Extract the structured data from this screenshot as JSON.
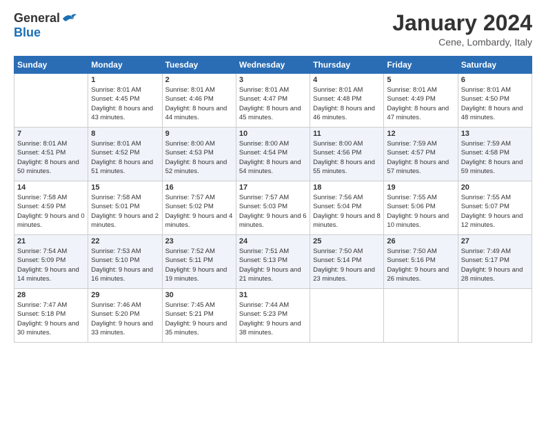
{
  "header": {
    "logo_general": "General",
    "logo_blue": "Blue",
    "month_title": "January 2024",
    "location": "Cene, Lombardy, Italy"
  },
  "weekdays": [
    "Sunday",
    "Monday",
    "Tuesday",
    "Wednesday",
    "Thursday",
    "Friday",
    "Saturday"
  ],
  "weeks": [
    [
      {
        "day": "",
        "sunrise": "",
        "sunset": "",
        "daylight": ""
      },
      {
        "day": "1",
        "sunrise": "Sunrise: 8:01 AM",
        "sunset": "Sunset: 4:45 PM",
        "daylight": "Daylight: 8 hours and 43 minutes."
      },
      {
        "day": "2",
        "sunrise": "Sunrise: 8:01 AM",
        "sunset": "Sunset: 4:46 PM",
        "daylight": "Daylight: 8 hours and 44 minutes."
      },
      {
        "day": "3",
        "sunrise": "Sunrise: 8:01 AM",
        "sunset": "Sunset: 4:47 PM",
        "daylight": "Daylight: 8 hours and 45 minutes."
      },
      {
        "day": "4",
        "sunrise": "Sunrise: 8:01 AM",
        "sunset": "Sunset: 4:48 PM",
        "daylight": "Daylight: 8 hours and 46 minutes."
      },
      {
        "day": "5",
        "sunrise": "Sunrise: 8:01 AM",
        "sunset": "Sunset: 4:49 PM",
        "daylight": "Daylight: 8 hours and 47 minutes."
      },
      {
        "day": "6",
        "sunrise": "Sunrise: 8:01 AM",
        "sunset": "Sunset: 4:50 PM",
        "daylight": "Daylight: 8 hours and 48 minutes."
      }
    ],
    [
      {
        "day": "7",
        "sunrise": "Sunrise: 8:01 AM",
        "sunset": "Sunset: 4:51 PM",
        "daylight": "Daylight: 8 hours and 50 minutes."
      },
      {
        "day": "8",
        "sunrise": "Sunrise: 8:01 AM",
        "sunset": "Sunset: 4:52 PM",
        "daylight": "Daylight: 8 hours and 51 minutes."
      },
      {
        "day": "9",
        "sunrise": "Sunrise: 8:00 AM",
        "sunset": "Sunset: 4:53 PM",
        "daylight": "Daylight: 8 hours and 52 minutes."
      },
      {
        "day": "10",
        "sunrise": "Sunrise: 8:00 AM",
        "sunset": "Sunset: 4:54 PM",
        "daylight": "Daylight: 8 hours and 54 minutes."
      },
      {
        "day": "11",
        "sunrise": "Sunrise: 8:00 AM",
        "sunset": "Sunset: 4:56 PM",
        "daylight": "Daylight: 8 hours and 55 minutes."
      },
      {
        "day": "12",
        "sunrise": "Sunrise: 7:59 AM",
        "sunset": "Sunset: 4:57 PM",
        "daylight": "Daylight: 8 hours and 57 minutes."
      },
      {
        "day": "13",
        "sunrise": "Sunrise: 7:59 AM",
        "sunset": "Sunset: 4:58 PM",
        "daylight": "Daylight: 8 hours and 59 minutes."
      }
    ],
    [
      {
        "day": "14",
        "sunrise": "Sunrise: 7:58 AM",
        "sunset": "Sunset: 4:59 PM",
        "daylight": "Daylight: 9 hours and 0 minutes."
      },
      {
        "day": "15",
        "sunrise": "Sunrise: 7:58 AM",
        "sunset": "Sunset: 5:01 PM",
        "daylight": "Daylight: 9 hours and 2 minutes."
      },
      {
        "day": "16",
        "sunrise": "Sunrise: 7:57 AM",
        "sunset": "Sunset: 5:02 PM",
        "daylight": "Daylight: 9 hours and 4 minutes."
      },
      {
        "day": "17",
        "sunrise": "Sunrise: 7:57 AM",
        "sunset": "Sunset: 5:03 PM",
        "daylight": "Daylight: 9 hours and 6 minutes."
      },
      {
        "day": "18",
        "sunrise": "Sunrise: 7:56 AM",
        "sunset": "Sunset: 5:04 PM",
        "daylight": "Daylight: 9 hours and 8 minutes."
      },
      {
        "day": "19",
        "sunrise": "Sunrise: 7:55 AM",
        "sunset": "Sunset: 5:06 PM",
        "daylight": "Daylight: 9 hours and 10 minutes."
      },
      {
        "day": "20",
        "sunrise": "Sunrise: 7:55 AM",
        "sunset": "Sunset: 5:07 PM",
        "daylight": "Daylight: 9 hours and 12 minutes."
      }
    ],
    [
      {
        "day": "21",
        "sunrise": "Sunrise: 7:54 AM",
        "sunset": "Sunset: 5:09 PM",
        "daylight": "Daylight: 9 hours and 14 minutes."
      },
      {
        "day": "22",
        "sunrise": "Sunrise: 7:53 AM",
        "sunset": "Sunset: 5:10 PM",
        "daylight": "Daylight: 9 hours and 16 minutes."
      },
      {
        "day": "23",
        "sunrise": "Sunrise: 7:52 AM",
        "sunset": "Sunset: 5:11 PM",
        "daylight": "Daylight: 9 hours and 19 minutes."
      },
      {
        "day": "24",
        "sunrise": "Sunrise: 7:51 AM",
        "sunset": "Sunset: 5:13 PM",
        "daylight": "Daylight: 9 hours and 21 minutes."
      },
      {
        "day": "25",
        "sunrise": "Sunrise: 7:50 AM",
        "sunset": "Sunset: 5:14 PM",
        "daylight": "Daylight: 9 hours and 23 minutes."
      },
      {
        "day": "26",
        "sunrise": "Sunrise: 7:50 AM",
        "sunset": "Sunset: 5:16 PM",
        "daylight": "Daylight: 9 hours and 26 minutes."
      },
      {
        "day": "27",
        "sunrise": "Sunrise: 7:49 AM",
        "sunset": "Sunset: 5:17 PM",
        "daylight": "Daylight: 9 hours and 28 minutes."
      }
    ],
    [
      {
        "day": "28",
        "sunrise": "Sunrise: 7:47 AM",
        "sunset": "Sunset: 5:18 PM",
        "daylight": "Daylight: 9 hours and 30 minutes."
      },
      {
        "day": "29",
        "sunrise": "Sunrise: 7:46 AM",
        "sunset": "Sunset: 5:20 PM",
        "daylight": "Daylight: 9 hours and 33 minutes."
      },
      {
        "day": "30",
        "sunrise": "Sunrise: 7:45 AM",
        "sunset": "Sunset: 5:21 PM",
        "daylight": "Daylight: 9 hours and 35 minutes."
      },
      {
        "day": "31",
        "sunrise": "Sunrise: 7:44 AM",
        "sunset": "Sunset: 5:23 PM",
        "daylight": "Daylight: 9 hours and 38 minutes."
      },
      {
        "day": "",
        "sunrise": "",
        "sunset": "",
        "daylight": ""
      },
      {
        "day": "",
        "sunrise": "",
        "sunset": "",
        "daylight": ""
      },
      {
        "day": "",
        "sunrise": "",
        "sunset": "",
        "daylight": ""
      }
    ]
  ]
}
